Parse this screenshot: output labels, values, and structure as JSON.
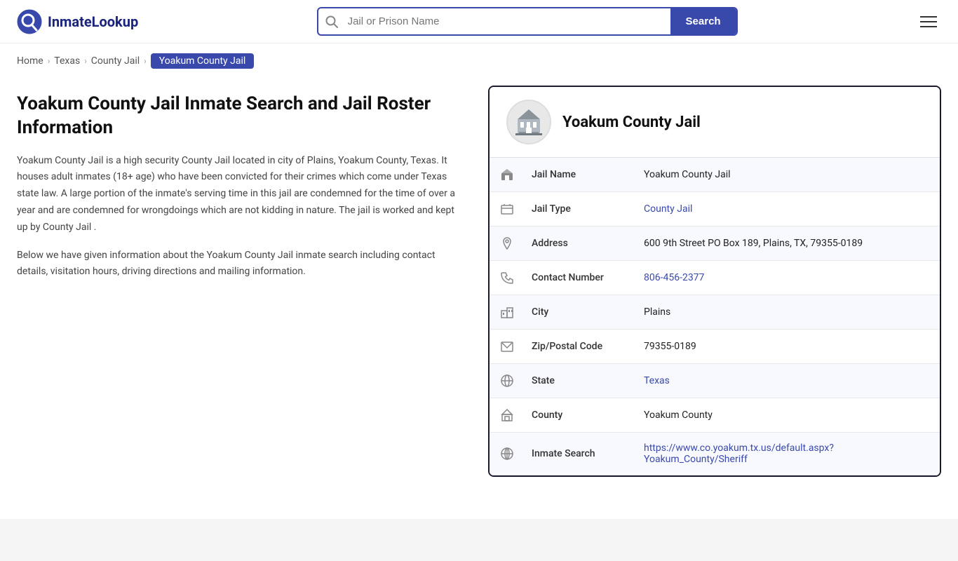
{
  "header": {
    "logo_text": "InmateLookup",
    "search_placeholder": "Jail or Prison Name",
    "search_btn_label": "Search"
  },
  "breadcrumb": {
    "home": "Home",
    "state": "Texas",
    "type": "County Jail",
    "current": "Yoakum County Jail"
  },
  "left": {
    "title": "Yoakum County Jail Inmate Search and Jail Roster Information",
    "desc1": "Yoakum County Jail is a high security County Jail located in city of Plains, Yoakum County, Texas. It houses adult inmates (18+ age) who have been convicted for their crimes which come under Texas state law. A large portion of the inmate's serving time in this jail are condemned for the time of over a year and are condemned for wrongdoings which are not kidding in nature. The jail is worked and kept up by County Jail .",
    "desc2": "Below we have given information about the Yoakum County Jail inmate search including contact details, visitation hours, driving directions and mailing information."
  },
  "card": {
    "title": "Yoakum County Jail",
    "rows": [
      {
        "icon": "jail-icon",
        "label": "Jail Name",
        "value": "Yoakum County Jail",
        "link": null
      },
      {
        "icon": "type-icon",
        "label": "Jail Type",
        "value": "County Jail",
        "link": "#"
      },
      {
        "icon": "address-icon",
        "label": "Address",
        "value": "600 9th Street PO Box 189, Plains, TX, 79355-0189",
        "link": null
      },
      {
        "icon": "phone-icon",
        "label": "Contact Number",
        "value": "806-456-2377",
        "link": "tel:806-456-2377"
      },
      {
        "icon": "city-icon",
        "label": "City",
        "value": "Plains",
        "link": null
      },
      {
        "icon": "zip-icon",
        "label": "Zip/Postal Code",
        "value": "79355-0189",
        "link": null
      },
      {
        "icon": "state-icon",
        "label": "State",
        "value": "Texas",
        "link": "#"
      },
      {
        "icon": "county-icon",
        "label": "County",
        "value": "Yoakum County",
        "link": null
      },
      {
        "icon": "globe-icon",
        "label": "Inmate Search",
        "value": "https://www.co.yoakum.tx.us/default.aspx?Yoakum_County/Sheriff",
        "link": "https://www.co.yoakum.tx.us/default.aspx?Yoakum_County/Sheriff"
      }
    ]
  }
}
